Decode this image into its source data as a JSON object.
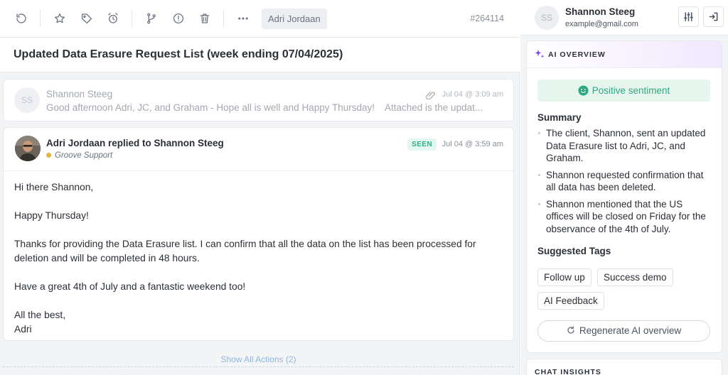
{
  "toolbar": {
    "icons": [
      "undo-icon",
      "star-icon",
      "tag-icon",
      "alarm-clock-icon",
      "branch-icon",
      "info-icon",
      "trash-icon",
      "more-icon"
    ],
    "assignee": "Adri Jordaan",
    "ticket_id": "#264114"
  },
  "ticket": {
    "title": "Updated Data Erasure Request List (week ending 07/04/2025)"
  },
  "collapsed_message": {
    "avatar_initials": "SS",
    "sender": "Shannon Steeg",
    "preview_start": "Good afternoon Adri, JC, and Graham - Hope all is well and Happy Thursday!",
    "preview_end": "Attached is the updat...",
    "time": "Jul 04 @ 3:09 am"
  },
  "open_message": {
    "header": "Adri Jordaan replied to Shannon Steeg",
    "mailbox": "Groove Support",
    "status": "SEEN",
    "time": "Jul 04 @ 3:59 am",
    "body": {
      "greeting": "Hi there Shannon,",
      "line1": "Happy Thursday!",
      "line2": "Thanks for providing the Data Erasure list. I can confirm that all the data on the list has been processed for deletion and will be completed in 48 hours.",
      "line3": "Have a great 4th of July and a fantastic weekend too!",
      "signoff": "All the best,",
      "signature": "Adri"
    }
  },
  "show_all_actions": "Show All Actions (2)",
  "contact": {
    "initials": "SS",
    "name": "Shannon Steeg",
    "email": "example@gmail.com"
  },
  "ai_overview": {
    "label": "AI OVERVIEW",
    "sentiment": "Positive sentiment",
    "summary_title": "Summary",
    "summary": [
      "The client, Shannon, sent an updated Data Erasure list to Adri, JC, and Graham.",
      "Shannon requested confirmation that all data has been deleted.",
      "Shannon mentioned that the US offices will be closed on Friday for the observance of the 4th of July."
    ],
    "tags_title": "Suggested Tags",
    "tags": [
      "Follow up",
      "Success demo",
      "AI Feedback"
    ],
    "regenerate": "Regenerate AI overview"
  },
  "chat_insights": {
    "label": "CHAT INSIGHTS"
  },
  "colors": {
    "accent_positive": "#2fa77e",
    "seen_badge": "#2fb386",
    "link": "#8fb7dd",
    "mailbox_dot": "#e3b53a"
  }
}
